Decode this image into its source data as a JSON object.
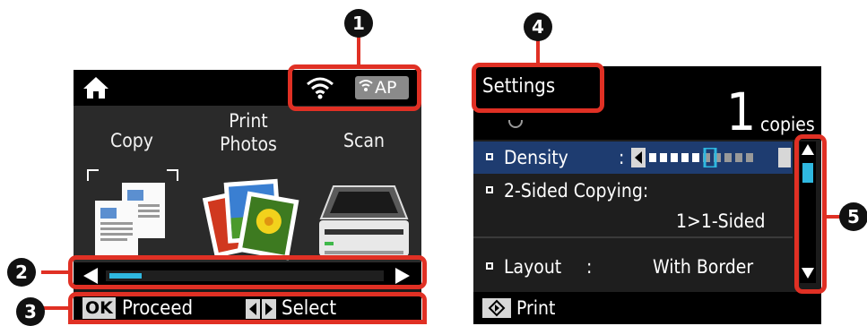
{
  "left_screen": {
    "icons": [
      "home-icon",
      "wifi-icon",
      "wifi-direct-ap-icon"
    ],
    "ap_label": "AP",
    "menu": [
      {
        "label": "Copy"
      },
      {
        "label": "Print\nPhotos"
      },
      {
        "label": "Scan"
      }
    ],
    "scroll_progress": 0.1,
    "footer": {
      "ok_key": "OK",
      "ok_action": "Proceed",
      "select_action": "Select"
    }
  },
  "right_screen": {
    "title": "Settings",
    "copies_number": "1",
    "copies_label": "copies",
    "rows": {
      "density": {
        "label": "Density",
        "sep": ":",
        "level": 0.5
      },
      "two_sided": {
        "label": "2-Sided Copying:",
        "value": "1>1-Sided"
      },
      "layout": {
        "label": "Layout",
        "sep": ":",
        "value": "With Border"
      }
    },
    "footer": {
      "print_label": "Print"
    }
  },
  "callouts": {
    "n1": "1",
    "n2": "2",
    "n3": "3",
    "n4": "4",
    "n5": "5"
  },
  "colors": {
    "callout": "#e03024",
    "highlight": "#1e3c70",
    "scroll_fill": "#2fb8e0"
  }
}
